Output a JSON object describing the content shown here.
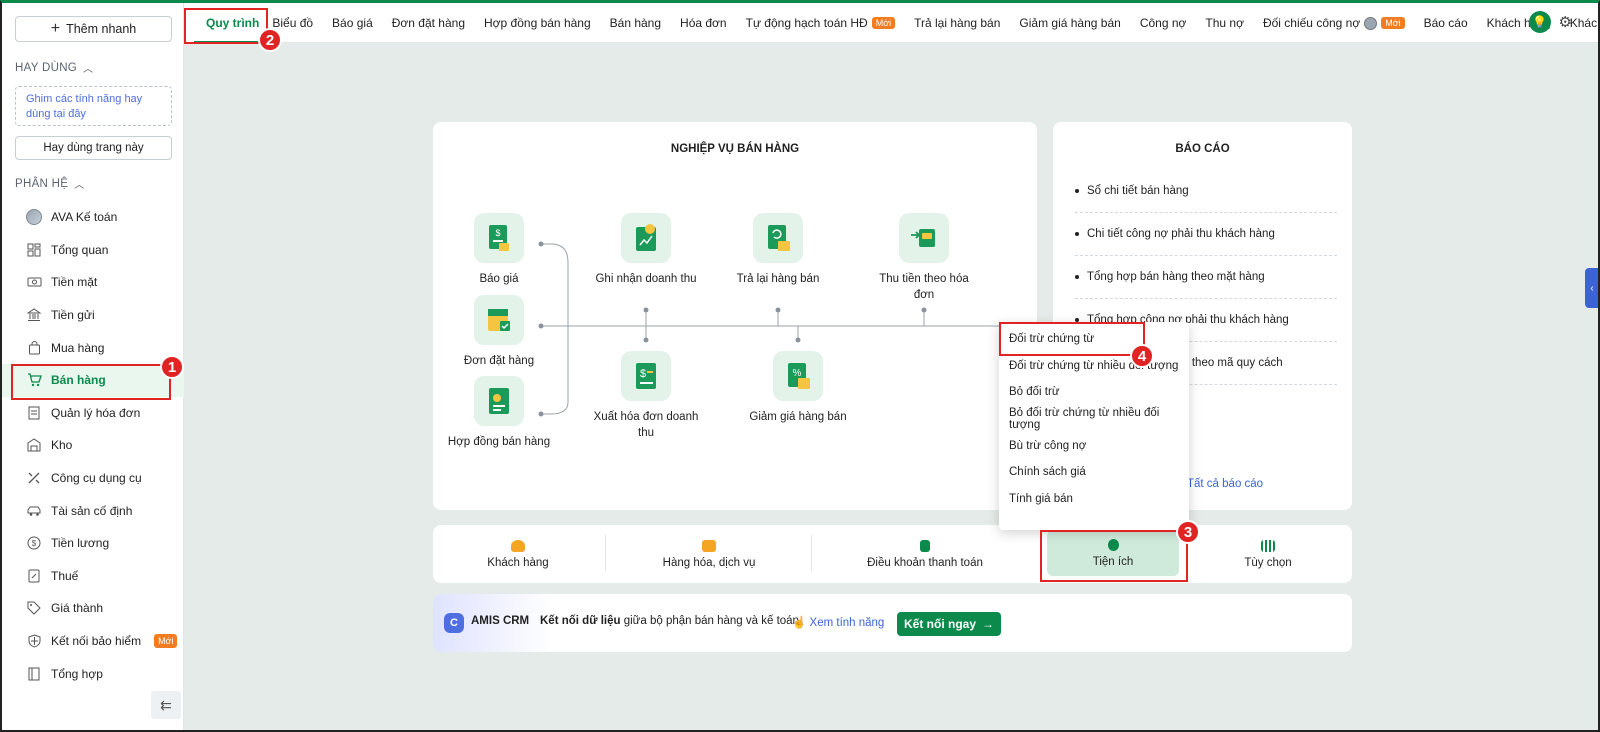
{
  "sidebar": {
    "quick_add_label": "Thêm nhanh",
    "often_title": "HAY DÙNG",
    "pin_hint": "Ghim các tính năng hay dùng tại đây",
    "often_button": "Hay dùng trang này",
    "modules_title": "PHÂN HỆ",
    "new_badge": "Mới",
    "items": [
      {
        "label": "AVA Kế toán",
        "icon": "avatar-icon"
      },
      {
        "label": "Tổng quan",
        "icon": "dashboard-icon"
      },
      {
        "label": "Tiền mặt",
        "icon": "cash-icon"
      },
      {
        "label": "Tiền gửi",
        "icon": "bank-icon"
      },
      {
        "label": "Mua hàng",
        "icon": "shopping-bag-icon"
      },
      {
        "label": "Bán hàng",
        "icon": "cart-icon"
      },
      {
        "label": "Quản lý hóa đơn",
        "icon": "invoice-icon"
      },
      {
        "label": "Kho",
        "icon": "warehouse-icon"
      },
      {
        "label": "Công cụ dụng cụ",
        "icon": "tools-icon"
      },
      {
        "label": "Tài sản cố định",
        "icon": "car-icon"
      },
      {
        "label": "Tiền lương",
        "icon": "dollar-coin-icon"
      },
      {
        "label": "Thuế",
        "icon": "tax-icon"
      },
      {
        "label": "Giá thành",
        "icon": "tag-icon"
      },
      {
        "label": "Kết nối bảo hiểm",
        "icon": "shield-icon"
      },
      {
        "label": "Tổng hợp",
        "icon": "book-icon"
      }
    ]
  },
  "tabs": [
    {
      "label": "Quy trình"
    },
    {
      "label": "Biểu đồ"
    },
    {
      "label": "Báo giá"
    },
    {
      "label": "Đơn đặt hàng"
    },
    {
      "label": "Hợp đồng bán hàng"
    },
    {
      "label": "Bán hàng"
    },
    {
      "label": "Hóa đơn"
    },
    {
      "label": "Tự động hạch toán HĐ",
      "badge": "Mới"
    },
    {
      "label": "Trả lại hàng bán"
    },
    {
      "label": "Giảm giá hàng bán"
    },
    {
      "label": "Công nợ"
    },
    {
      "label": "Thu nợ"
    },
    {
      "label": "Đối chiếu công nợ",
      "badge": "Mới"
    },
    {
      "label": "Báo cáo"
    },
    {
      "label": "Khách hàng"
    },
    {
      "label": "Khác"
    }
  ],
  "process": {
    "title": "NGHIỆP VỤ BÁN HÀNG",
    "nodes": {
      "quote": "Báo giá",
      "order": "Đơn đặt hàng",
      "contract": "Hợp đồng bán hàng",
      "revenue": "Ghi nhận doanh thu",
      "invoice": "Xuất hóa đơn doanh thu",
      "returns": "Trả lại hàng bán",
      "discount": "Giảm giá hàng bán",
      "collect": "Thu tiền theo hóa đơn"
    }
  },
  "reports": {
    "title": "BÁO CÁO",
    "items": [
      "Sổ chi tiết bán hàng",
      "Chi tiết công nợ phải thu khách hàng",
      "Tổng hợp bán hàng theo mặt hàng",
      "Tổng hợp công nợ phải thu khách hàng",
      "Sổ chi tiết bán hàng theo mã quy cách"
    ],
    "more": "Tất cả báo cáo"
  },
  "dropdown": {
    "items": [
      "Đối trừ chứng từ",
      "Đối trừ chứng từ nhiều đối tượng",
      "Bỏ đối trừ",
      "Bỏ đối trừ chứng từ nhiều đối tượng",
      "Bù trừ công nợ",
      "Chính sách giá",
      "Tính giá bán"
    ]
  },
  "bottom_tabs": [
    {
      "label": "Khách hàng",
      "color": "#f5a524"
    },
    {
      "label": "Hàng hóa, dịch vụ",
      "color": "#f5a524"
    },
    {
      "label": "Điều khoản thanh toán",
      "color": "#0b8a4b"
    },
    {
      "label": "Tiện ích",
      "color": "#0b8a4b"
    },
    {
      "label": "Tùy chọn",
      "color": "#0b8a4b"
    }
  ],
  "crm": {
    "name": "AMIS CRM",
    "text_bold": "Kết nối dữ liệu",
    "text_rest": " giữa bộ phận bán hàng và kế toán",
    "feature_link": "Xem tính năng",
    "button": "Kết nối ngay"
  },
  "annotations": [
    "1",
    "2",
    "3",
    "4"
  ],
  "colors": {
    "primary": "#0b8a4b",
    "highlight": "#e02424",
    "badge": "#f47c20",
    "link": "#3b63d6"
  }
}
